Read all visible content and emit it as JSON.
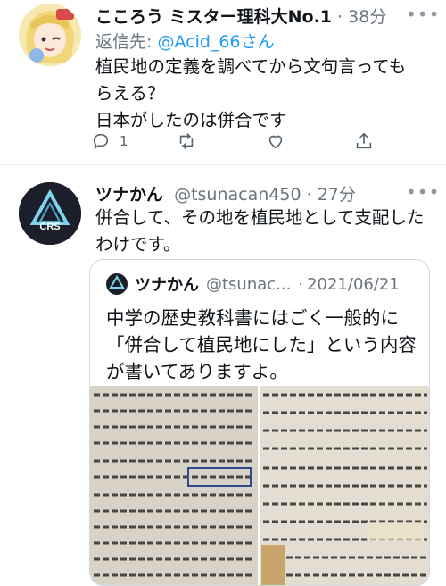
{
  "tweet1": {
    "display_name": "こころう ミスター理科大No.1",
    "time": "38分",
    "replying_prefix": "返信先: ",
    "replying_handle": "@Acid_66さん",
    "text_lines": [
      "植民地の定義を調べてから文句言っても",
      "らえる？",
      "日本がしたのは併合です"
    ],
    "reply_count": "1",
    "more_label": "•••"
  },
  "tweet2": {
    "display_name": "ツナかん",
    "handle": "@tsunacan450",
    "time": "27分",
    "text_lines": [
      "併合して、その地を植民地として支配した",
      "わけです。"
    ],
    "more_label": "•••",
    "avatar_text": "CRS"
  },
  "quote": {
    "display_name": "ツナかん",
    "handle": "@tsunac...",
    "date": "2021/06/21",
    "text_lines": [
      "中学の歴史教科書にはごく一般的に",
      "「併合して植民地にした」という内容",
      "が書いてありますよ。"
    ],
    "avatar_text": "CRS"
  },
  "colors": {
    "link": "#1d9bf0",
    "muted": "#6b7580",
    "text": "#0f1419",
    "border": "#cfd9de"
  },
  "icons": [
    "reply-icon",
    "retweet-icon",
    "like-icon",
    "share-icon",
    "more-icon"
  ]
}
